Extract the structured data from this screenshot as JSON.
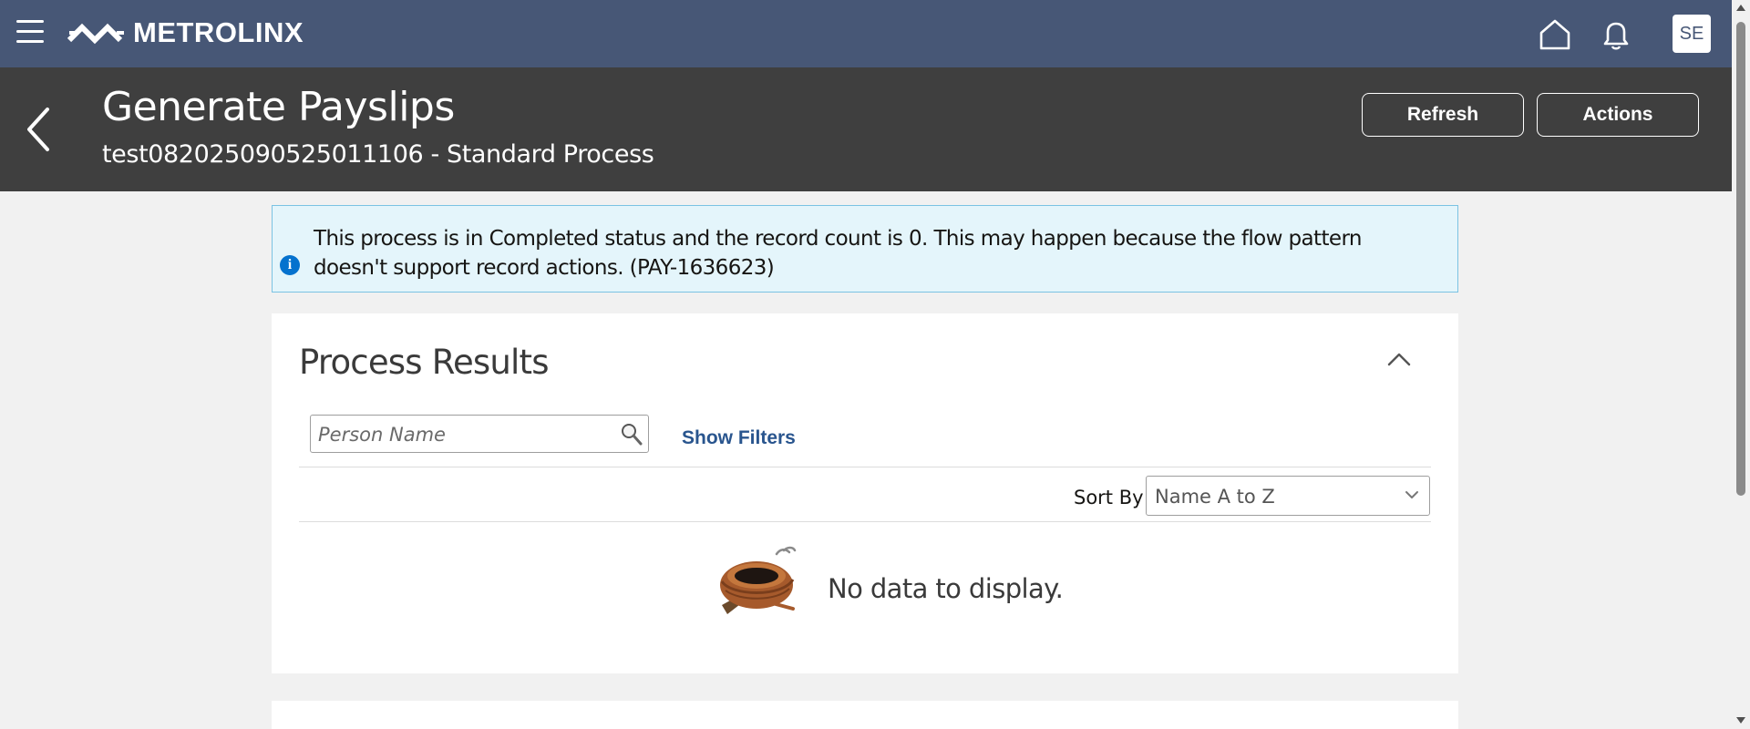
{
  "topbar": {
    "brand": "METROLINX",
    "menu_icon": "hamburger-menu-icon",
    "home_icon": "home-icon",
    "notifications_icon": "bell-icon",
    "user_initials": "SE",
    "bg_color": "#475776"
  },
  "header": {
    "title": "Generate Payslips",
    "subtitle": "test082025090525011106 - Standard Process",
    "back_icon": "chevron-left-icon",
    "refresh_label": "Refresh",
    "actions_label": "Actions",
    "bg_color": "#3f3f3f"
  },
  "info_banner": {
    "icon": "info-icon",
    "icon_glyph": "i",
    "message": "This process is in Completed status and the record count is 0. This may happen because the flow pattern doesn't support record actions. (PAY-1636623)"
  },
  "process_results": {
    "title": "Process Results",
    "collapse_icon": "chevron-up-icon",
    "search": {
      "placeholder": "Person Name",
      "value": "",
      "icon": "search-icon"
    },
    "show_filters_label": "Show Filters",
    "sort_by_label": "Sort By",
    "sort_by_value": "Name A to Z",
    "empty_state": {
      "icon": "empty-nest-icon",
      "message": "No data to display."
    }
  },
  "colors": {
    "link": "#29558e",
    "info_bg": "#e4f5fb",
    "info_border": "#7bc3e3",
    "info_icon": "#0572ce"
  }
}
